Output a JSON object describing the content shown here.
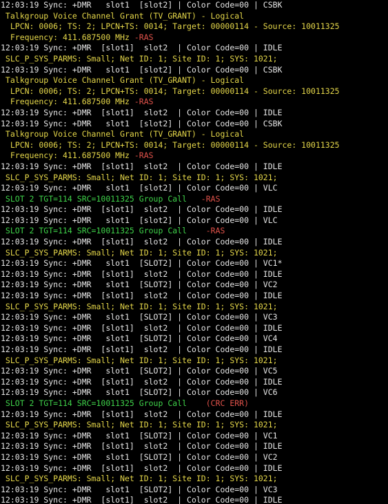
{
  "colors": {
    "background": "#000000",
    "white": "#e8e8e8",
    "yellow": "#e6d84a",
    "red": "#e0524a",
    "green": "#3fd44a"
  },
  "lines": [
    [
      {
        "t": "12:03:19 Sync: +DMR   slot1  [slot2] | Color Code=00 | CSBK",
        "c": "white"
      }
    ],
    [
      {
        "t": " Talkgroup Voice Channel Grant (TV_GRANT) - Logical",
        "c": "yellow"
      }
    ],
    [
      {
        "t": "  LPCN: 0006; TS: 2; LPCN+TS: 0014; Target: 00000114 - Source: 10011325",
        "c": "yellow"
      }
    ],
    [
      {
        "t": "  Frequency: 411.687500 MHz ",
        "c": "yellow"
      },
      {
        "t": "-RAS",
        "c": "red"
      }
    ],
    [
      {
        "t": "12:03:19 Sync: +DMR  [slot1]  slot2  | Color Code=00 | IDLE",
        "c": "white"
      }
    ],
    [
      {
        "t": " SLC_P_SYS_PARMS: Small; Net ID: 1; Site ID: 1; SYS: 1021;",
        "c": "yellow"
      }
    ],
    [
      {
        "t": "12:03:19 Sync: +DMR   slot1  [slot2] | Color Code=00 | CSBK",
        "c": "white"
      }
    ],
    [
      {
        "t": " Talkgroup Voice Channel Grant (TV_GRANT) - Logical",
        "c": "yellow"
      }
    ],
    [
      {
        "t": "  LPCN: 0006; TS: 2; LPCN+TS: 0014; Target: 00000114 - Source: 10011325",
        "c": "yellow"
      }
    ],
    [
      {
        "t": "  Frequency: 411.687500 MHz ",
        "c": "yellow"
      },
      {
        "t": "-RAS",
        "c": "red"
      }
    ],
    [
      {
        "t": "12:03:19 Sync: +DMR  [slot1]  slot2  | Color Code=00 | IDLE",
        "c": "white"
      }
    ],
    [
      {
        "t": "12:03:19 Sync: +DMR   slot1  [slot2] | Color Code=00 | CSBK",
        "c": "white"
      }
    ],
    [
      {
        "t": " Talkgroup Voice Channel Grant (TV_GRANT) - Logical",
        "c": "yellow"
      }
    ],
    [
      {
        "t": "  LPCN: 0006; TS: 2; LPCN+TS: 0014; Target: 00000114 - Source: 10011325",
        "c": "yellow"
      }
    ],
    [
      {
        "t": "  Frequency: 411.687500 MHz ",
        "c": "yellow"
      },
      {
        "t": "-RAS",
        "c": "red"
      }
    ],
    [
      {
        "t": "12:03:19 Sync: +DMR  [slot1]  slot2  | Color Code=00 | IDLE",
        "c": "white"
      }
    ],
    [
      {
        "t": " SLC_P_SYS_PARMS: Small; Net ID: 1; Site ID: 1; SYS: 1021;",
        "c": "yellow"
      }
    ],
    [
      {
        "t": "12:03:19 Sync: +DMR   slot1  [slot2] | Color Code=00 | VLC",
        "c": "white"
      }
    ],
    [
      {
        "t": " SLOT 2 TGT=114 SRC=10011325 Group Call   ",
        "c": "green"
      },
      {
        "t": "-RAS",
        "c": "red"
      }
    ],
    [
      {
        "t": "12:03:19 Sync: +DMR  [slot1]  slot2  | Color Code=00 | IDLE",
        "c": "white"
      }
    ],
    [
      {
        "t": "12:03:19 Sync: +DMR   slot1  [slot2] | Color Code=00 | VLC",
        "c": "white"
      }
    ],
    [
      {
        "t": " SLOT 2 TGT=114 SRC=10011325 Group Call    ",
        "c": "green"
      },
      {
        "t": "-RAS",
        "c": "red"
      }
    ],
    [
      {
        "t": "12:03:19 Sync: +DMR  [slot1]  slot2  | Color Code=00 | IDLE",
        "c": "white"
      }
    ],
    [
      {
        "t": " SLC_P_SYS_PARMS: Small; Net ID: 1; Site ID: 1; SYS: 1021;",
        "c": "yellow"
      }
    ],
    [
      {
        "t": "12:03:19 Sync: +DMR   slot1  [SLOT2] | Color Code=00 | VC1*",
        "c": "white"
      }
    ],
    [
      {
        "t": "12:03:19 Sync: +DMR  [slot1]  slot2  | Color Code=00 | IDLE",
        "c": "white"
      }
    ],
    [
      {
        "t": "12:03:19 Sync: +DMR   slot1  [SLOT2] | Color Code=00 | VC2",
        "c": "white"
      }
    ],
    [
      {
        "t": "12:03:19 Sync: +DMR  [slot1]  slot2  | Color Code=00 | IDLE",
        "c": "white"
      }
    ],
    [
      {
        "t": " SLC_P_SYS_PARMS: Small; Net ID: 1; Site ID: 1; SYS: 1021;",
        "c": "yellow"
      }
    ],
    [
      {
        "t": "12:03:19 Sync: +DMR   slot1  [SLOT2] | Color Code=00 | VC3",
        "c": "white"
      }
    ],
    [
      {
        "t": "12:03:19 Sync: +DMR  [slot1]  slot2  | Color Code=00 | IDLE",
        "c": "white"
      }
    ],
    [
      {
        "t": "12:03:19 Sync: +DMR   slot1  [SLOT2] | Color Code=00 | VC4",
        "c": "white"
      }
    ],
    [
      {
        "t": "12:03:19 Sync: +DMR  [slot1]  slot2  | Color Code=00 | IDLE",
        "c": "white"
      }
    ],
    [
      {
        "t": " SLC_P_SYS_PARMS: Small; Net ID: 1; Site ID: 1; SYS: 1021;",
        "c": "yellow"
      }
    ],
    [
      {
        "t": "12:03:19 Sync: +DMR   slot1  [SLOT2] | Color Code=00 | VC5",
        "c": "white"
      }
    ],
    [
      {
        "t": "12:03:19 Sync: +DMR  [slot1]  slot2  | Color Code=00 | IDLE",
        "c": "white"
      }
    ],
    [
      {
        "t": "12:03:19 Sync: +DMR   slot1  [SLOT2] | Color Code=00 | VC6",
        "c": "white"
      }
    ],
    [
      {
        "t": " SLOT 2 TGT=114 SRC=10011325 Group Call    ",
        "c": "green"
      },
      {
        "t": "(CRC ERR)",
        "c": "red"
      }
    ],
    [
      {
        "t": "12:03:19 Sync: +DMR  [slot1]  slot2  | Color Code=00 | IDLE",
        "c": "white"
      }
    ],
    [
      {
        "t": " SLC_P_SYS_PARMS: Small; Net ID: 1; Site ID: 1; SYS: 1021;",
        "c": "yellow"
      }
    ],
    [
      {
        "t": "12:03:19 Sync: +DMR   slot1  [SLOT2] | Color Code=00 | VC1",
        "c": "white"
      }
    ],
    [
      {
        "t": "12:03:19 Sync: +DMR  [slot1]  slot2  | Color Code=00 | IDLE",
        "c": "white"
      }
    ],
    [
      {
        "t": "12:03:19 Sync: +DMR   slot1  [SLOT2] | Color Code=00 | VC2",
        "c": "white"
      }
    ],
    [
      {
        "t": "12:03:19 Sync: +DMR  [slot1]  slot2  | Color Code=00 | IDLE",
        "c": "white"
      }
    ],
    [
      {
        "t": " SLC_P_SYS_PARMS: Small; Net ID: 1; Site ID: 1; SYS: 1021;",
        "c": "yellow"
      }
    ],
    [
      {
        "t": "12:03:19 Sync: +DMR   slot1  [SLOT2] | Color Code=00 | VC3",
        "c": "white"
      }
    ],
    [
      {
        "t": "12:03:19 Sync: +DMR  [slot1]  slot2  | Color Code=00 | IDLE",
        "c": "white"
      }
    ]
  ]
}
